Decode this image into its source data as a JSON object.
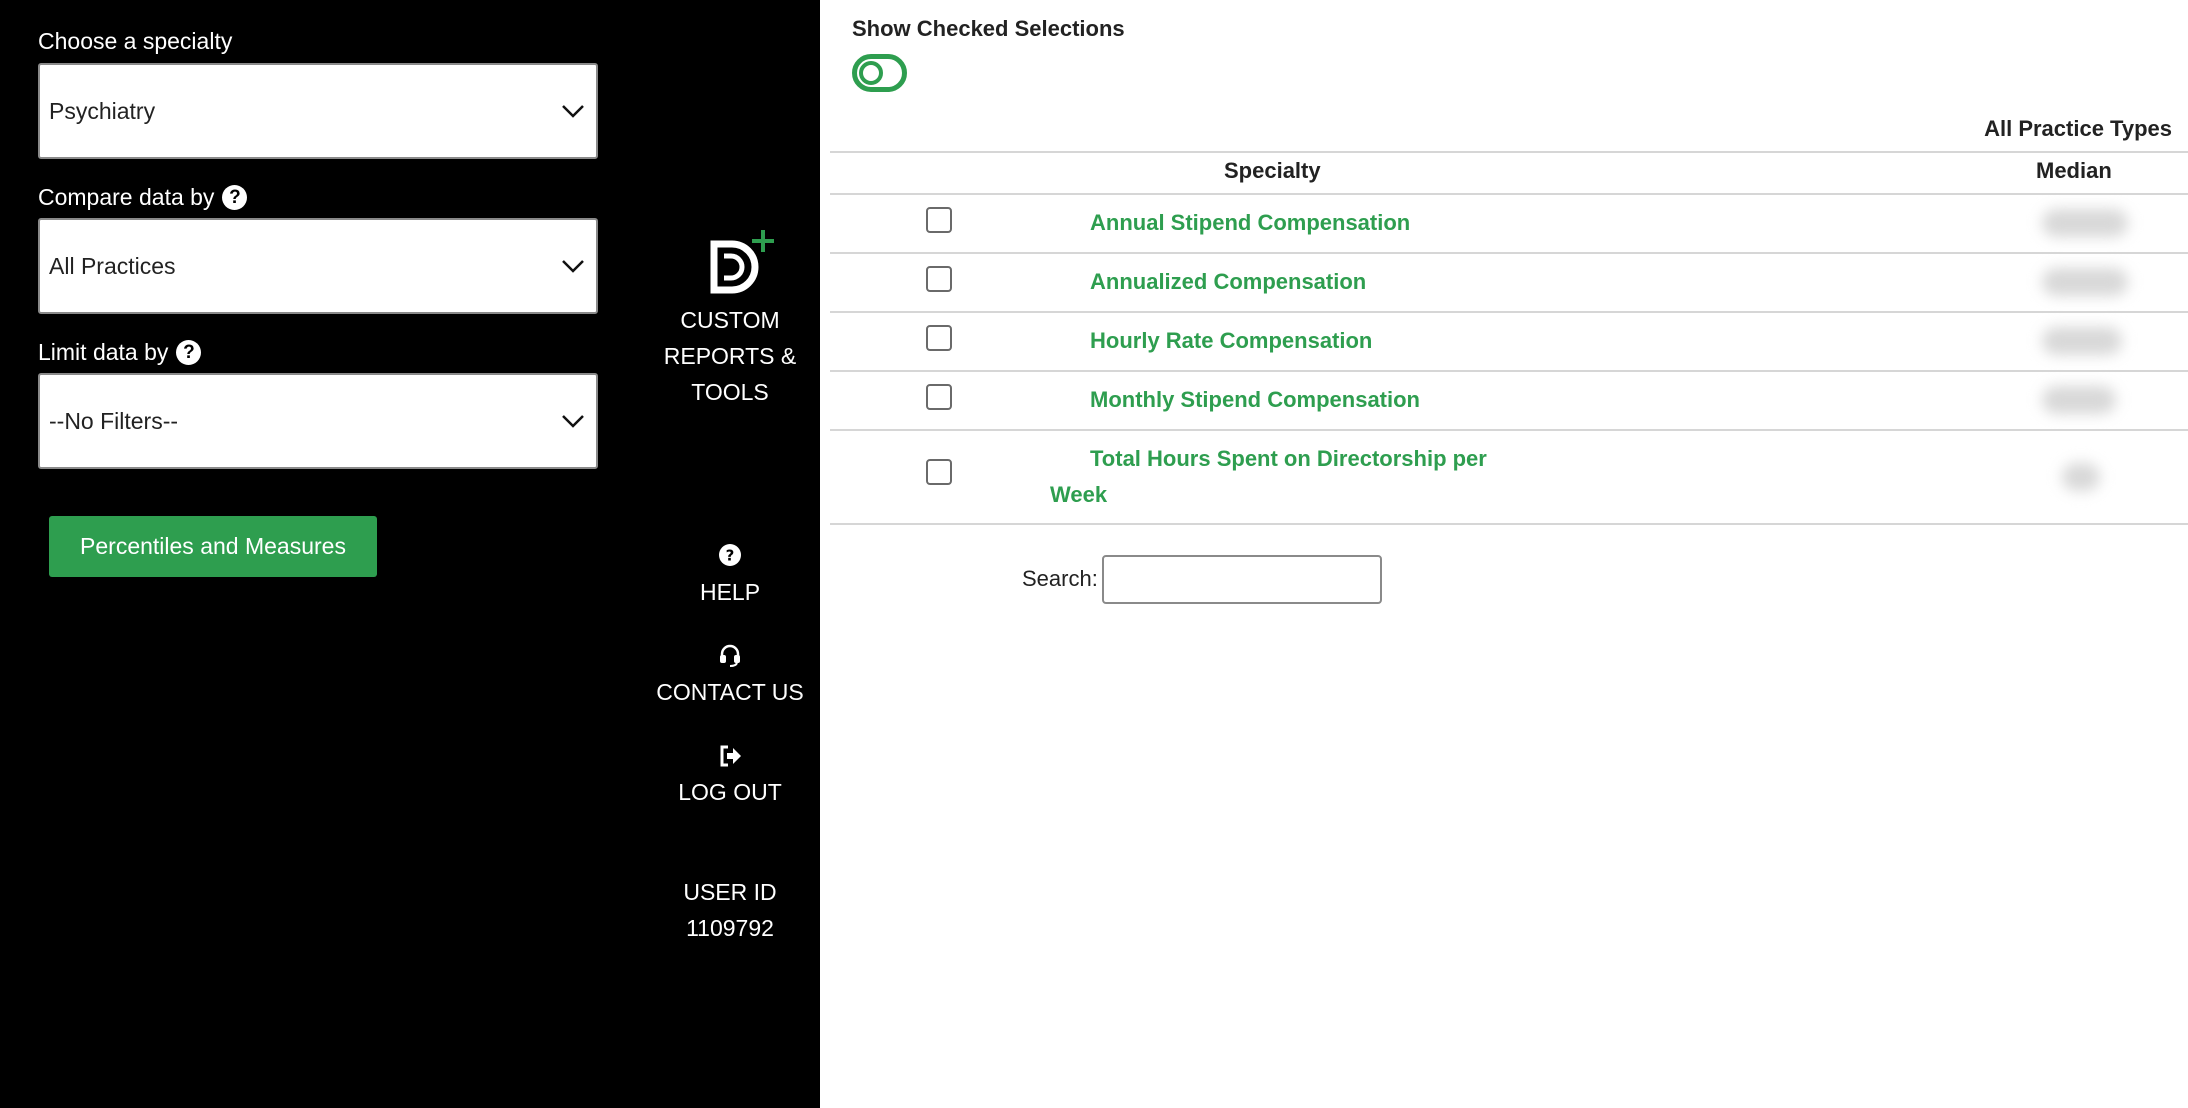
{
  "filters": {
    "specialty": {
      "label": "Choose a specialty",
      "value": "Psychiatry"
    },
    "compare": {
      "label": "Compare data by",
      "value": "All Practices"
    },
    "limit": {
      "label": "Limit data by",
      "value": "--No Filters--"
    },
    "percentiles_button": "Percentiles and Measures"
  },
  "nav": {
    "custom_reports": "CUSTOM REPORTS & TOOLS",
    "help": "HELP",
    "contact": "CONTACT US",
    "logout": "LOG OUT",
    "user_id_label": "USER ID",
    "user_id": "1109792"
  },
  "main": {
    "show_checked_label": "Show Checked Selections",
    "practice_types_header": "All Practice Types",
    "columns": {
      "specialty": "Specialty",
      "median": "Median"
    },
    "rows": [
      {
        "label": "Annual Stipend Compensation"
      },
      {
        "label": "Annualized Compensation"
      },
      {
        "label": "Hourly Rate Compensation"
      },
      {
        "label": "Monthly Stipend Compensation"
      },
      {
        "label": "Total Hours Spent on Directorship per Week"
      }
    ],
    "search_label": "Search:",
    "search_value": ""
  },
  "colors": {
    "accent": "#2e9e4f",
    "panel": "#000000"
  },
  "icons": [
    "chevron-down-icon",
    "help-icon",
    "headset-icon",
    "logout-icon",
    "brand-logo-icon"
  ]
}
